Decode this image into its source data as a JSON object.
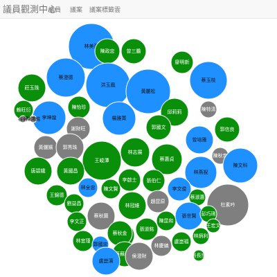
{
  "header": {
    "brand": "議員觀測中心",
    "nav": [
      {
        "label": "議員"
      },
      {
        "label": "議案"
      },
      {
        "label": "議案標籤雲"
      }
    ]
  },
  "colors": {
    "green": "#0a8f0a",
    "blue": "#1e90ff",
    "gray": "#7f7f7f"
  },
  "chart_data": {
    "type": "bubble",
    "legend": "none",
    "nodes": [
      {
        "name": "林美燕",
        "group": "blue",
        "size": 33
      },
      {
        "name": "陳政忠",
        "group": "green",
        "size": 18
      },
      {
        "name": "曾三膽",
        "group": "green",
        "size": 18
      },
      {
        "name": "廖明新",
        "group": "green",
        "size": 16
      },
      {
        "name": "蔡澄德",
        "group": "blue",
        "size": 28
      },
      {
        "name": "洪玉鳳",
        "group": "blue",
        "size": 32
      },
      {
        "name": "黃麗松",
        "group": "blue",
        "size": 32
      },
      {
        "name": "蔡玉枝",
        "group": "blue",
        "size": 27
      },
      {
        "name": "莊玉珠",
        "group": "green",
        "size": 20
      },
      {
        "name": "李坤煌",
        "group": "blue",
        "size": 24
      },
      {
        "name": "陳怡珍",
        "group": "green",
        "size": 16
      },
      {
        "name": "楊雅菁",
        "group": "blue",
        "size": 24
      },
      {
        "name": "邱莉莉",
        "group": "green",
        "size": 20
      },
      {
        "name": "陳特清",
        "group": "gray",
        "size": 12
      },
      {
        "name": "賴旺衍",
        "group": "green",
        "size": 14
      },
      {
        "name": "谷蓉",
        "group": "gray",
        "size": 5
      },
      {
        "name": "陳鴻銘",
        "group": "gray",
        "size": 5
      },
      {
        "name": "謝財旺",
        "group": "gray",
        "size": 17
      },
      {
        "name": "郭國文",
        "group": "green",
        "size": 18
      },
      {
        "name": "曾培雅",
        "group": "blue",
        "size": 20
      },
      {
        "name": "郭信良",
        "group": "green",
        "size": 18
      },
      {
        "name": "黃儷嬪",
        "group": "gray",
        "size": 17
      },
      {
        "name": "郭秀珠",
        "group": "gray",
        "size": 20
      },
      {
        "name": "林志展",
        "group": "green",
        "size": 21
      },
      {
        "name": "陳秋宏",
        "group": "gray",
        "size": 12
      },
      {
        "name": "王峻潭",
        "group": "green",
        "size": 28
      },
      {
        "name": "蔡惠貞",
        "group": "green",
        "size": 22
      },
      {
        "name": "陳文科",
        "group": "blue",
        "size": 25
      },
      {
        "name": "唐碧娥",
        "group": "green",
        "size": 20
      },
      {
        "name": "黃國昌",
        "group": "green",
        "size": 20
      },
      {
        "name": "李啟士",
        "group": "green",
        "size": 16
      },
      {
        "name": "張伯仁",
        "group": "green",
        "size": 16
      },
      {
        "name": "林燕祝",
        "group": "blue",
        "size": 23
      },
      {
        "name": "林全忠",
        "group": "blue",
        "size": 14
      },
      {
        "name": "陳文賢",
        "group": "green",
        "size": 14
      },
      {
        "name": "李文俊",
        "group": "blue",
        "size": 17
      },
      {
        "name": "王錦德",
        "group": "green",
        "size": 15
      },
      {
        "name": "蔡淑惠",
        "group": "green",
        "size": 12
      },
      {
        "name": "杜素吟",
        "group": "gray",
        "size": 30
      },
      {
        "name": "劉益昌",
        "group": "green",
        "size": 14
      },
      {
        "name": "蔡秋蘭",
        "group": "gray",
        "size": 20
      },
      {
        "name": "林冠維",
        "group": "green",
        "size": 20
      },
      {
        "name": "趙昆原",
        "group": "gray",
        "size": 16
      },
      {
        "name": "李文正",
        "group": "green",
        "size": 14
      },
      {
        "name": "張世賢",
        "group": "blue",
        "size": 20
      },
      {
        "name": "彭巧琍",
        "group": "green",
        "size": 12
      },
      {
        "name": "王宏文",
        "group": "green",
        "size": 10
      },
      {
        "name": "盧崑福",
        "group": "green",
        "size": 18
      },
      {
        "name": "張道銘",
        "group": "green",
        "size": 16
      },
      {
        "name": "陳昆和",
        "group": "green",
        "size": 14
      },
      {
        "name": "林宜瑾",
        "group": "green",
        "size": 15
      },
      {
        "name": "鄭國忠",
        "group": "blue",
        "size": 12
      },
      {
        "name": "林慶鎮",
        "group": "gray",
        "size": 15
      },
      {
        "name": "林炳利",
        "group": "green",
        "size": 12
      },
      {
        "name": "盧崑福2",
        "group": "green",
        "size": 14
      },
      {
        "name": "蔡秋金",
        "group": "green",
        "size": 18
      },
      {
        "name": "張長宗",
        "group": "green",
        "size": 8
      },
      {
        "name": "蔡蘇秋金",
        "group": "green",
        "size": 18
      },
      {
        "name": "盧崑濱",
        "group": "blue",
        "size": 20
      },
      {
        "name": "侯澄財",
        "group": "gray",
        "size": 20
      }
    ]
  }
}
